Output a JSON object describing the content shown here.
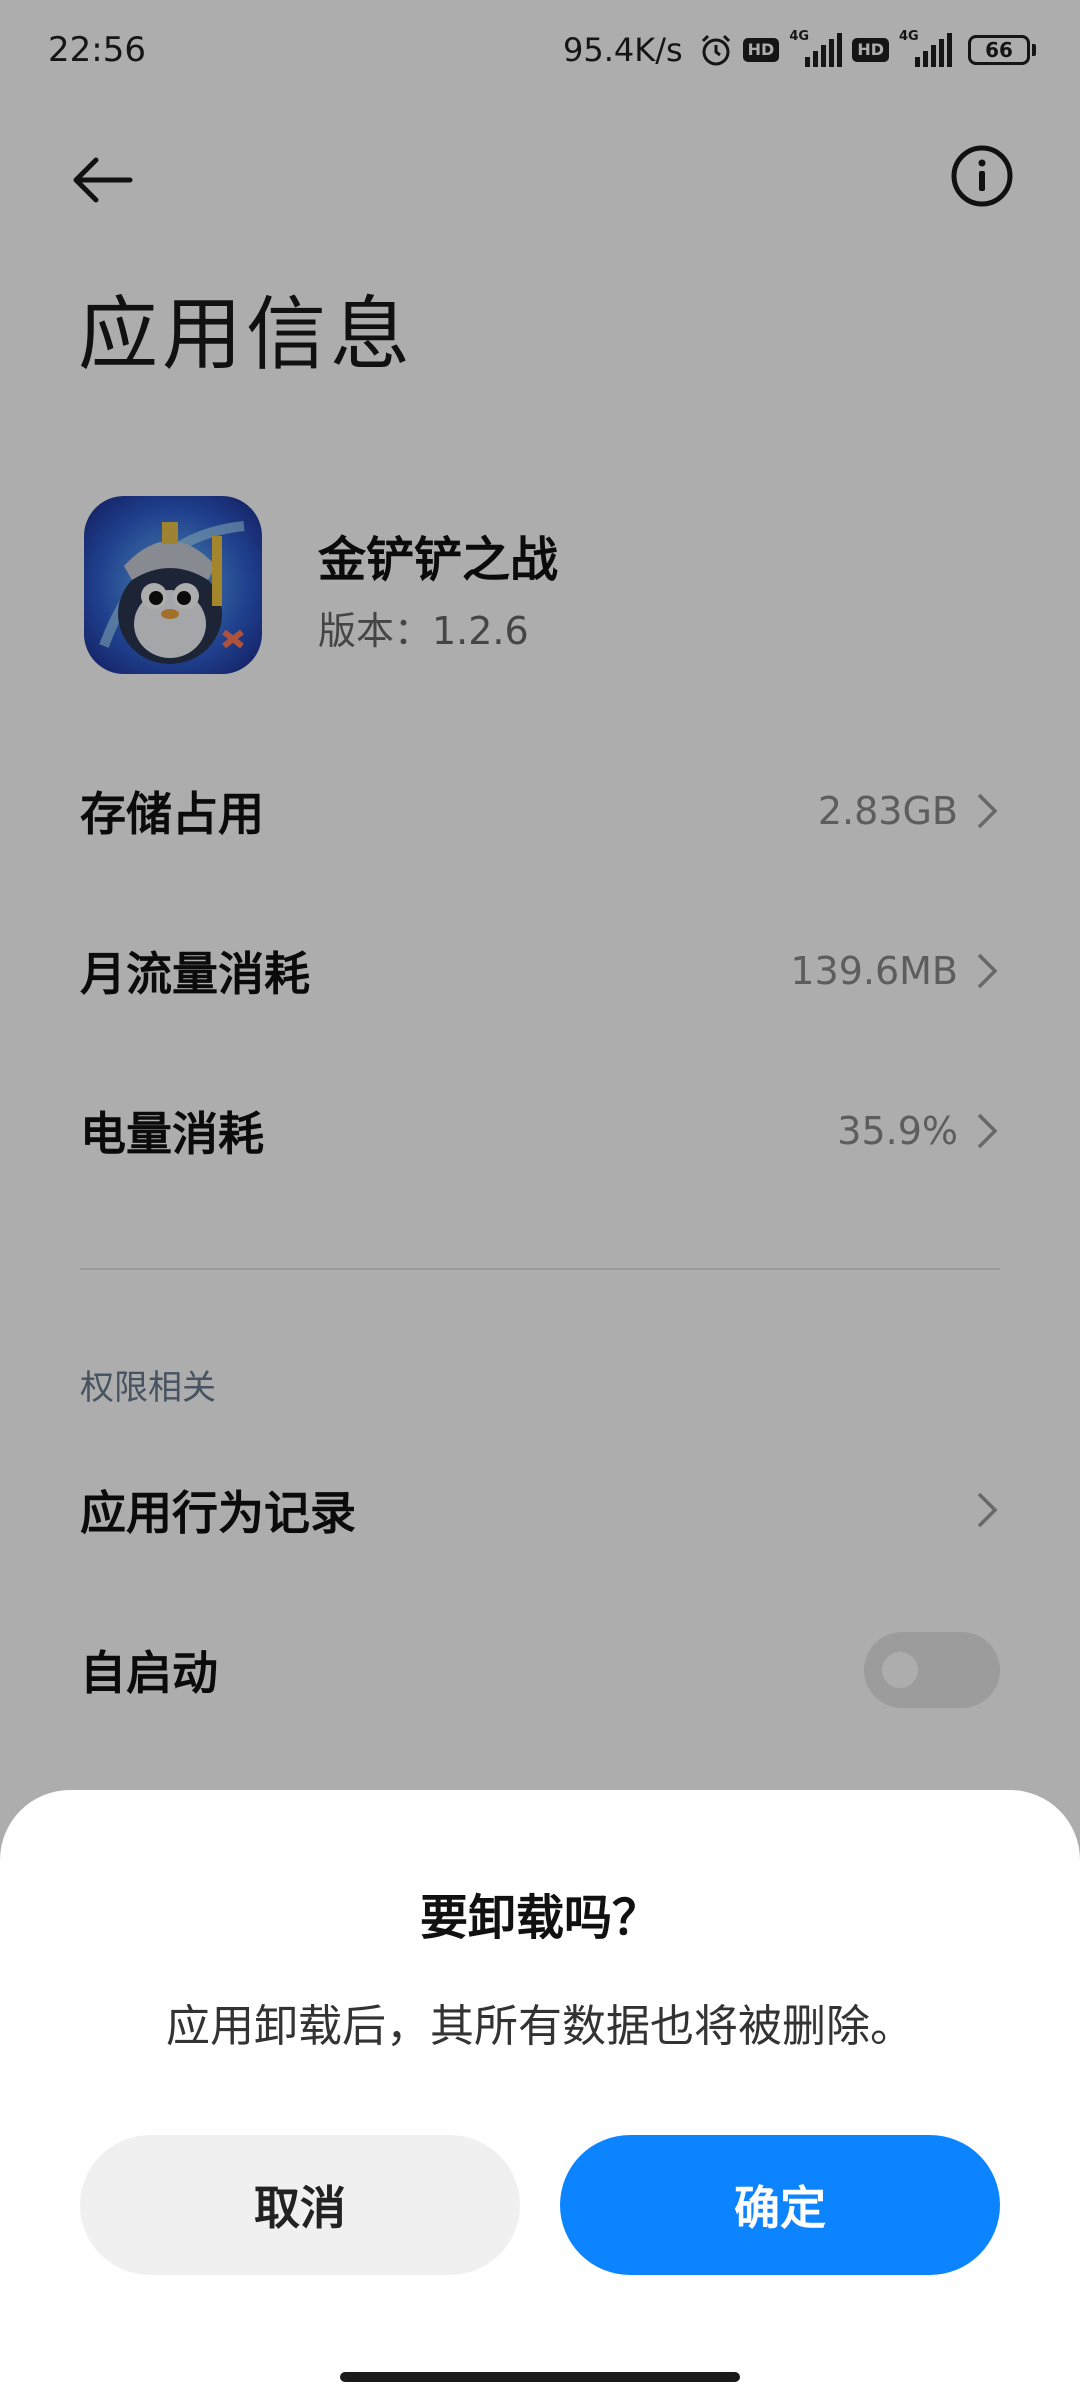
{
  "status_bar": {
    "time": "22:56",
    "net_speed": "95.4K/s",
    "hd": "HD",
    "signal_tag": "4G",
    "battery_level": "66"
  },
  "header": {
    "title": "应用信息"
  },
  "app": {
    "name": "金铲铲之战",
    "version": "版本：1.2.6"
  },
  "rows": {
    "storage": {
      "label": "存储占用",
      "value": "2.83GB"
    },
    "traffic": {
      "label": "月流量消耗",
      "value": "139.6MB"
    },
    "battery": {
      "label": "电量消耗",
      "value": "35.9%"
    }
  },
  "permissions": {
    "section_label": "权限相关",
    "behavior_log": {
      "label": "应用行为记录"
    },
    "autostart": {
      "label": "自启动",
      "enabled": false
    }
  },
  "dialog": {
    "title": "要卸载吗？",
    "message": "应用卸载后，其所有数据也将被删除。",
    "cancel_label": "取消",
    "confirm_label": "确定"
  },
  "colors": {
    "accent": "#0d84ff",
    "overlay": "rgba(0,0,0,0.32)"
  }
}
